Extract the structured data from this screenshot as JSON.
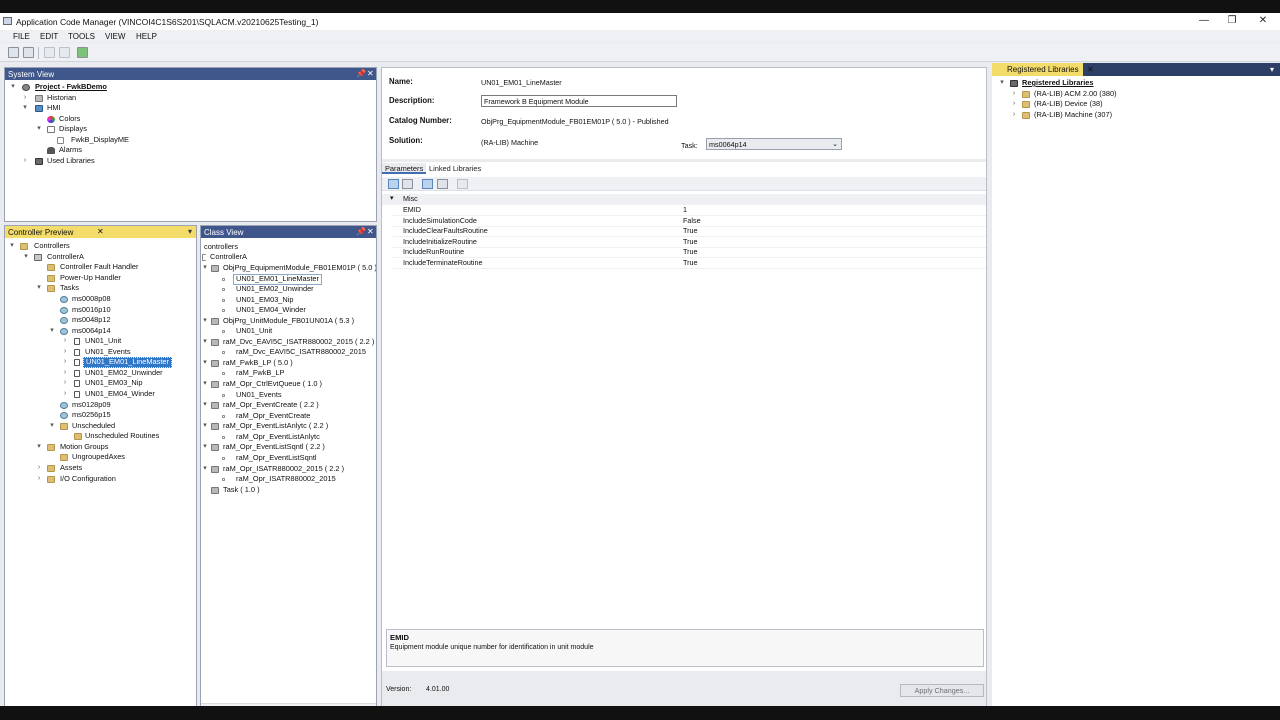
{
  "window": {
    "title": "Application Code Manager (VINCOI4C1S6S201\\SQLACM.v20210625Testing_1)",
    "min": "—",
    "restore": "❐",
    "close": "✕"
  },
  "menu": [
    "FILE",
    "EDIT",
    "TOOLS",
    "VIEW",
    "HELP"
  ],
  "system_view": {
    "title": "System View",
    "pin": "📌",
    "close": "✕",
    "items": [
      "Project - FwkBDemo",
      "Historian",
      "HMI",
      "Colors",
      "Displays",
      "FwkB_DisplayME",
      "Alarms",
      "Used Libraries"
    ]
  },
  "controller_preview": {
    "title": "Controller Preview",
    "close": "✕",
    "menu": "▾",
    "items": [
      "Controllers",
      "ControllerA",
      "Controller Fault Handler",
      "Power-Up Handler",
      "Tasks",
      "ms0008p08",
      "ms0016p10",
      "ms0048p12",
      "ms0064p14",
      "UN01_Unit",
      "UN01_Events",
      "UN01_EM01_LineMaster",
      "UN01_EM02_Unwinder",
      "UN01_EM03_Nip",
      "UN01_EM04_Winder",
      "ms0128p09",
      "ms0256p15",
      "Unscheduled",
      "Unscheduled Routines",
      "Motion Groups",
      "UngroupedAxes",
      "Assets",
      "I/O Configuration"
    ]
  },
  "class_view": {
    "title": "Class View",
    "pin": "📌",
    "close": "✕",
    "items": [
      "controllers",
      "ControllerA",
      "ObjPrg_EquipmentModule_FB01EM01P  ( 5.0 )",
      "UN01_EM01_LineMaster",
      "UN01_EM02_Unwinder",
      "UN01_EM03_Nip",
      "UN01_EM04_Winder",
      "ObjPrg_UnitModule_FB01UN01A  ( 5.3 )",
      "UN01_Unit",
      "raM_Dvc_EAVI5C_ISATR880002_2015  ( 2.2 )",
      "raM_Dvc_EAVI5C_ISATR880002_2015",
      "raM_FwkB_LP  ( 5.0 )",
      "raM_FwkB_LP",
      "raM_Opr_CtrlEvtQueue  ( 1.0 )",
      "UN01_Events",
      "raM_Opr_EventCreate  ( 2.2 )",
      "raM_Opr_EventCreate",
      "raM_Opr_EventListAnlytc  ( 2.2 )",
      "raM_Opr_EventListAnlytc",
      "raM_Opr_EventListSqntl  ( 2.2 )",
      "raM_Opr_EventListSqntl",
      "raM_Opr_ISATR880002_2015  ( 2.2 )",
      "raM_Opr_ISATR880002_2015",
      "Task  ( 1.0 )"
    ]
  },
  "details": {
    "name_label": "Name:",
    "name_value": "UN01_EM01_LineMaster",
    "description_label": "Description:",
    "description_value": "Framework B Equipment Module",
    "catalog_label": "Catalog Number:",
    "catalog_value": "ObjPrg_EquipmentModule_FB01EM01P   ( 5.0 )  - Published",
    "solution_label": "Solution:",
    "solution_value": "(RA-LIB) Machine",
    "task_label": "Task:",
    "task_value": "ms0064p14",
    "tabs": [
      "Parameters",
      "Linked Libraries"
    ],
    "category": "Misc",
    "parameters": [
      {
        "name": "EMID",
        "value": "1"
      },
      {
        "name": "IncludeSimulationCode",
        "value": "False"
      },
      {
        "name": "IncludeClearFaultsRoutine",
        "value": "True"
      },
      {
        "name": "IncludeInitializeRoutine",
        "value": "True"
      },
      {
        "name": "IncludeRunRoutine",
        "value": "True"
      },
      {
        "name": "IncludeTerminateRoutine",
        "value": "True"
      }
    ],
    "help_title": "EMID",
    "help_text": "Equipment module unique number for identification in unit module",
    "version_label": "Version:",
    "version_value": "4.01.00",
    "apply_button": "Apply Changes..."
  },
  "registered_libraries": {
    "title": "Registered Libraries",
    "close": "✕",
    "menu": "▾",
    "items": [
      "Registered Libraries",
      "(RA-LIB) ACM 2.00  (380)",
      "(RA-LIB) Device  (38)",
      "(RA-LIB) Machine  (307)"
    ]
  },
  "colors": {
    "pane_header": "#40578c",
    "active_header": "#f4dc6a",
    "selection": "#3177c8",
    "frame": "#e9ebef"
  }
}
